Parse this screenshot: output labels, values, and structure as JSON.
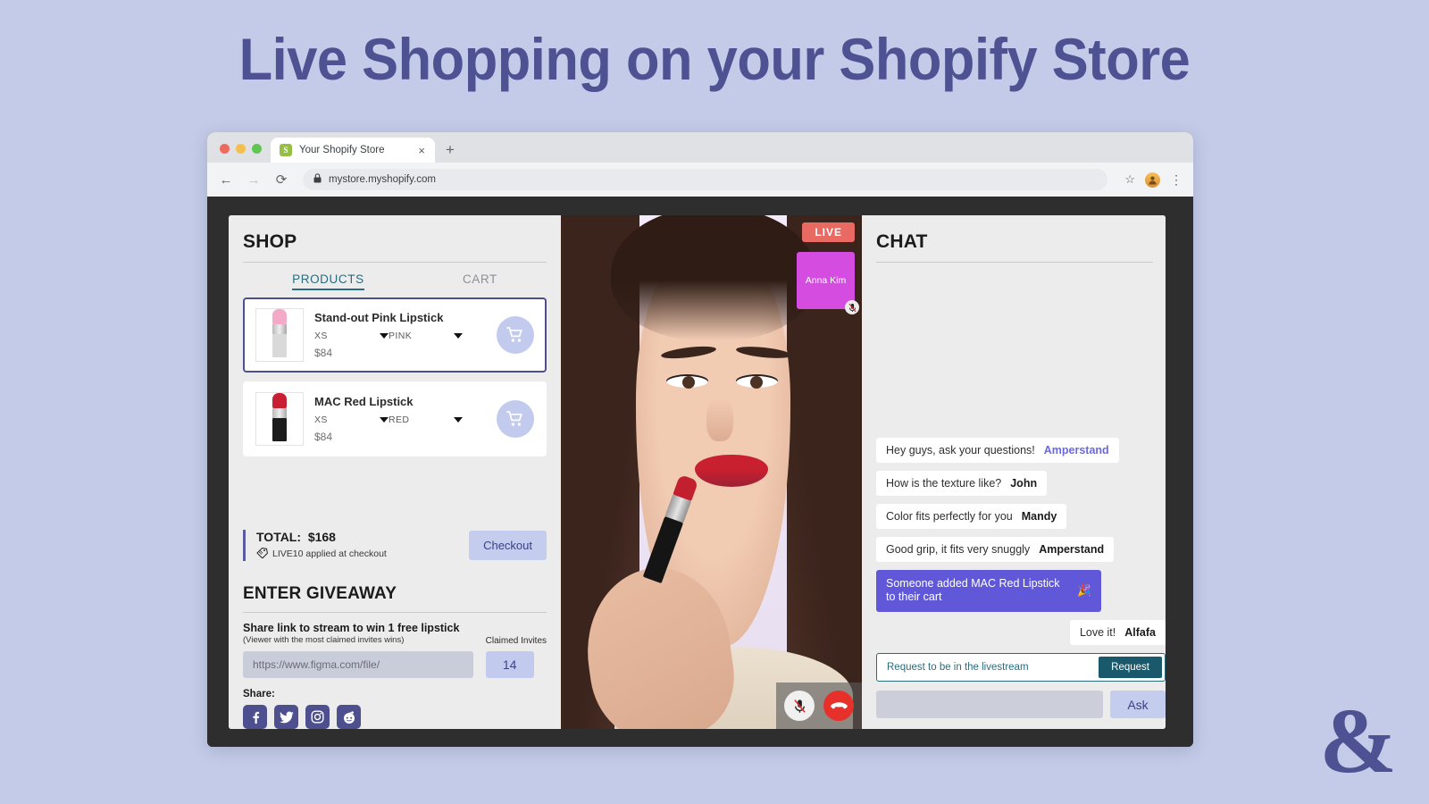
{
  "headline": "Live Shopping on your Shopify Store",
  "watermark": "&",
  "browser": {
    "tab_title": "Your Shopify Store",
    "favicon_glyph": "S",
    "tab_close": "×",
    "new_tab": "+",
    "back": "←",
    "forward": "→",
    "reload": "⟳",
    "lock_icon": "🔒",
    "url": "mystore.myshopify.com",
    "bookmark_star": "☆",
    "menu": "⋮"
  },
  "shop": {
    "title": "SHOP",
    "tabs": [
      {
        "label": "PRODUCTS",
        "active": true
      },
      {
        "label": "CART",
        "active": false
      }
    ],
    "products": [
      {
        "name": "Stand-out Pink Lipstick",
        "size": "XS",
        "color": "PINK",
        "price": "$84",
        "selected": true,
        "cart_icon": "cart-icon"
      },
      {
        "name": "MAC Red Lipstick",
        "size": "XS",
        "color": "RED",
        "price": "$84",
        "selected": false,
        "cart_icon": "cart-icon"
      }
    ],
    "total_label": "TOTAL:",
    "total_value": "$168",
    "promo_text": "LIVE10 applied at checkout",
    "promo_icon": "🏷",
    "checkout_label": "Checkout"
  },
  "giveaway": {
    "title": "ENTER GIVEAWAY",
    "heading": "Share link to stream to win 1 free lipstick",
    "subheading": "(Viewer with the most claimed invites wins)",
    "link_value": "https://www.figma.com/file/",
    "invites_label": "Claimed Invites",
    "invites_count": "14",
    "share_label": "Share:",
    "socials": [
      {
        "name": "facebook-icon",
        "glyph": "f"
      },
      {
        "name": "twitter-icon",
        "glyph": "ᴠ"
      },
      {
        "name": "instagram-icon",
        "glyph": "▢"
      },
      {
        "name": "reddit-icon",
        "glyph": "●"
      }
    ]
  },
  "video": {
    "live_badge": "LIVE",
    "presenter_name": "Anna Kim",
    "presenter_mic_icon": "mic-muted-icon",
    "mute_button_icon": "mic-muted-icon",
    "end_call_icon": "end-call-icon"
  },
  "chat": {
    "title": "CHAT",
    "messages": [
      {
        "text": "Hey guys, ask your questions!",
        "who": "Amperstand",
        "style": "accent",
        "align": "left"
      },
      {
        "text": "How is the texture like?",
        "who": "John",
        "style": "bold",
        "align": "left"
      },
      {
        "text": "Color fits perfectly for you",
        "who": "Mandy",
        "style": "bold",
        "align": "left"
      },
      {
        "text": "Good grip, it fits very snuggly",
        "who": "Amperstand",
        "style": "bold",
        "align": "left"
      },
      {
        "text": "Someone added MAC Red Lipstick to their cart",
        "who": "",
        "style": "notice",
        "align": "left",
        "emoji": "🎉"
      },
      {
        "text": "Love it!",
        "who": "Alfafa",
        "style": "bold",
        "align": "right"
      }
    ],
    "request_placeholder": "Request to be in the livestream",
    "request_button": "Request",
    "ask_input_value": "",
    "ask_button": "Ask"
  },
  "colors": {
    "page_bg": "#c3cbe8",
    "headline": "#4e5192",
    "accent_purple": "#4e4f8f",
    "notice_purple": "#6058d8",
    "teal": "#2a6b7c",
    "live_red": "#e86a63",
    "presenter_magenta": "#d44ce0",
    "periwinkle": "#c5cdee"
  }
}
